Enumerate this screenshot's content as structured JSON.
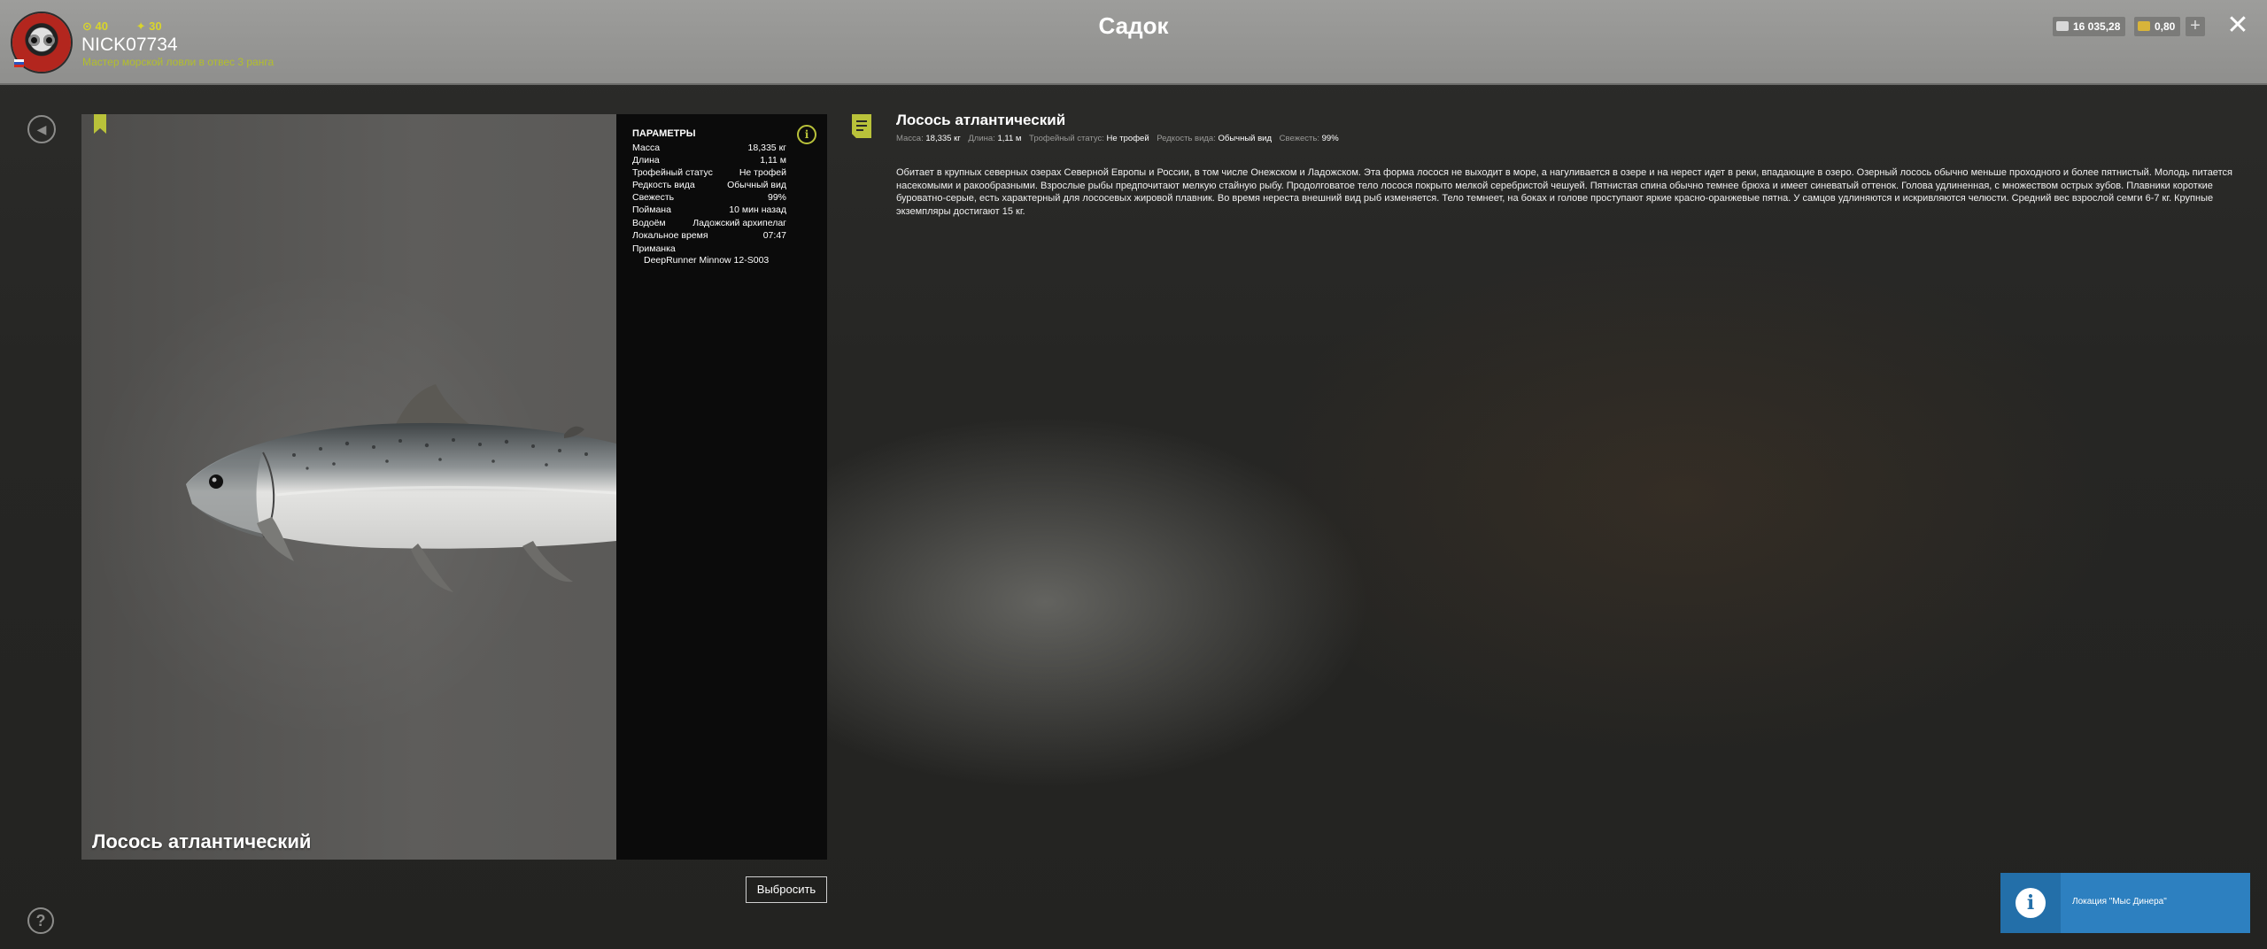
{
  "header": {
    "title": "Садок",
    "player": {
      "level_stat": "40",
      "rating_stat": "30",
      "username": "NICK07734",
      "rank": "Мастер морской ловли в отвес 3 ранга"
    },
    "currency": {
      "silver": "16 035,28",
      "gold": "0,80",
      "add_label": "+"
    },
    "close_label": "✕"
  },
  "fish": {
    "name": "Лосось атлантический",
    "params_title": "ПАРАМЕТРЫ",
    "params": [
      {
        "key": "Масса",
        "value": "18,335 кг"
      },
      {
        "key": "Длина",
        "value": "1,11 м"
      },
      {
        "key": "Трофейный статус",
        "value": "Не трофей"
      },
      {
        "key": "Редкость вида",
        "value": "Обычный вид"
      },
      {
        "key": "Свежесть",
        "value": "99%"
      },
      {
        "key": "Поймана",
        "value": "10 мин назад"
      },
      {
        "key": "Водоём",
        "value": "Ладожский архипелаг"
      },
      {
        "key": "Локальное время",
        "value": "07:47"
      }
    ],
    "lure_label": "Приманка",
    "lure_value": "DeepRunner Minnow 12-S003",
    "discard_label": "Выбросить"
  },
  "description": {
    "title": "Лосось атлантический",
    "meta": [
      {
        "key": "Масса:",
        "value": "18,335 кг"
      },
      {
        "key": "Длина:",
        "value": "1,11 м"
      },
      {
        "key": "Трофейный статус:",
        "value": "Не трофей"
      },
      {
        "key": "Редкость вида:",
        "value": "Обычный вид"
      },
      {
        "key": "Свежесть:",
        "value": "99%"
      }
    ],
    "text": "Обитает в крупных северных озерах Северной Европы и России, в том числе Онежском и Ладожском. Эта форма лосося не выходит в море, а нагуливается в озере и на нерест идет в реки, впадающие в озеро. Озерный лосось обычно меньше проходного и более пятнистый. Молодь питается насекомыми и ракообразными. Взрослые рыбы предпочитают мелкую стайную рыбу. Продолговатое тело лосося покрыто мелкой серебристой чешуей. Пятнистая спина обычно темнее брюха и имеет синеватый оттенок. Голова удлиненная, с множеством острых зубов. Плавники короткие буроватно-серые, есть характерный для лососевых жировой плавник. Во время нереста внешний вид рыб изменяется. Тело темнеет, на боках и голове проступают яркие красно-оранжевые пятна. У самцов удлиняются и искривляются челюсти. Средний вес взрослой семги 6-7 кг. Крупные экземпляры достигают 15 кг."
  },
  "notification": {
    "text": "Локация \"Мыс Динера\""
  },
  "colors": {
    "accent": "#b9c23a",
    "notification": "#2d80c0"
  },
  "icons": [
    "back-icon",
    "help-icon",
    "bookmark-icon",
    "info-icon",
    "document-icon",
    "close-icon",
    "silver-coin-icon",
    "gold-coin-icon"
  ]
}
